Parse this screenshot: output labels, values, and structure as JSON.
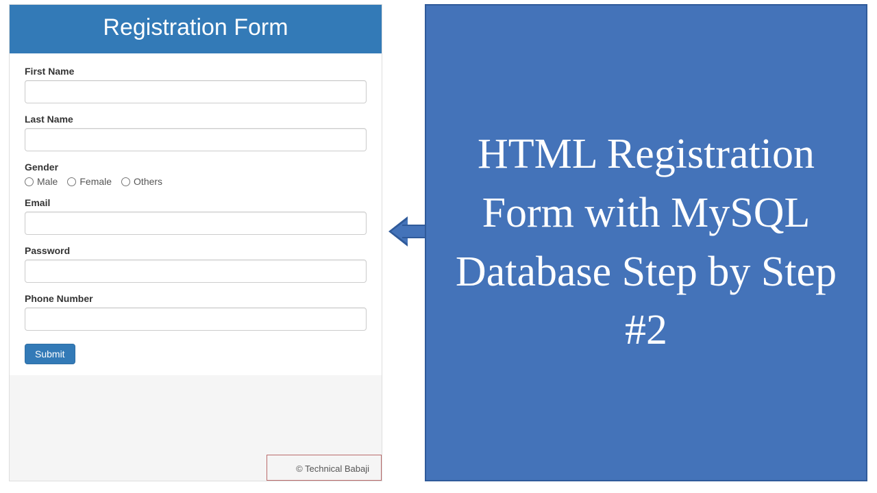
{
  "form": {
    "title": "Registration Form",
    "fields": {
      "first_name": {
        "label": "First Name",
        "value": ""
      },
      "last_name": {
        "label": "Last Name",
        "value": ""
      },
      "gender": {
        "label": "Gender",
        "options": [
          "Male",
          "Female",
          "Others"
        ]
      },
      "email": {
        "label": "Email",
        "value": ""
      },
      "password": {
        "label": "Password",
        "value": ""
      },
      "phone": {
        "label": "Phone Number",
        "value": ""
      }
    },
    "submit_label": "Submit",
    "footer": "© Technical Babaji"
  },
  "promo": {
    "text": "HTML Registration Form with MySQL Database Step by Step #2"
  }
}
